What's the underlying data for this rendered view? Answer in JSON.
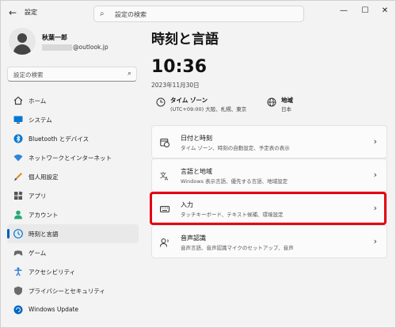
{
  "window": {
    "title": "設定"
  },
  "search": {
    "top_placeholder": "設定の検索",
    "side_placeholder": "設定の検索"
  },
  "profile": {
    "name": "秋葉一郎",
    "email_suffix": "@outlook.jp"
  },
  "sidebar": {
    "items": [
      {
        "label": "ホーム",
        "icon": "home-icon"
      },
      {
        "label": "システム",
        "icon": "system-icon"
      },
      {
        "label": "Bluetooth とデバイス",
        "icon": "bluetooth-icon"
      },
      {
        "label": "ネットワークとインターネット",
        "icon": "wifi-icon"
      },
      {
        "label": "個人用設定",
        "icon": "brush-icon"
      },
      {
        "label": "アプリ",
        "icon": "apps-icon"
      },
      {
        "label": "アカウント",
        "icon": "account-icon"
      },
      {
        "label": "時刻と言語",
        "icon": "time-language-icon",
        "active": true
      },
      {
        "label": "ゲーム",
        "icon": "gamepad-icon"
      },
      {
        "label": "アクセシビリティ",
        "icon": "accessibility-icon"
      },
      {
        "label": "プライバシーとセキュリティ",
        "icon": "shield-icon"
      },
      {
        "label": "Windows Update",
        "icon": "update-icon"
      }
    ]
  },
  "main": {
    "title": "時刻と言語",
    "time": "10:36",
    "date": "2023年11月30日",
    "timezone": {
      "title": "タイム ゾーン",
      "value": "(UTC+09:00) 大阪、札幌、東京"
    },
    "region": {
      "title": "地域",
      "value": "日本"
    },
    "cards": [
      {
        "title": "日付と時刻",
        "subtitle": "タイム ゾーン、時刻の自動設定、予定表の表示",
        "icon": "calendar-clock-icon"
      },
      {
        "title": "言語と地域",
        "subtitle": "Windows 表示言語、優先する言語、地域設定",
        "icon": "language-icon"
      },
      {
        "title": "入力",
        "subtitle": "タッチキーボード、テキスト候補、環境設定",
        "icon": "keyboard-icon",
        "highlighted": true
      },
      {
        "title": "音声認識",
        "subtitle": "音声言語、音声認識マイクのセットアップ、音声",
        "icon": "speech-icon"
      }
    ]
  },
  "colors": {
    "accent": "#005fb8",
    "highlight": "#e60012",
    "background": "#f3f3f3",
    "card": "#fbfbfb"
  }
}
